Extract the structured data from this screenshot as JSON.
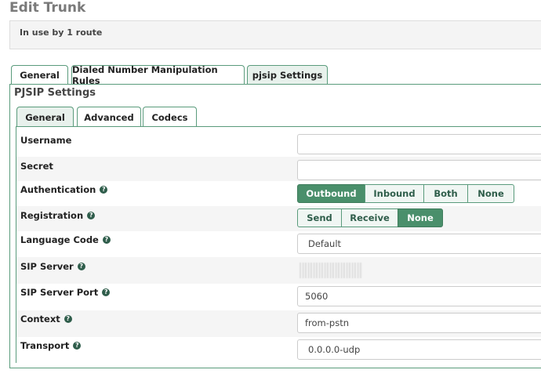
{
  "page": {
    "title": "Edit Trunk"
  },
  "alert": {
    "text": "In use by 1 route"
  },
  "outer_tabs": [
    {
      "label": "General",
      "active": false
    },
    {
      "label": "Dialed Number Manipulation Rules",
      "active": false
    },
    {
      "label": "pjsip Settings",
      "active": true
    }
  ],
  "section": {
    "title": "PJSIP Settings"
  },
  "inner_tabs": [
    {
      "label": "General",
      "active": true
    },
    {
      "label": "Advanced",
      "active": false
    },
    {
      "label": "Codecs",
      "active": false
    }
  ],
  "fields": {
    "username": {
      "label": "Username",
      "value": ""
    },
    "secret": {
      "label": "Secret",
      "value": ""
    },
    "authentication": {
      "label": "Authentication",
      "options": [
        "Outbound",
        "Inbound",
        "Both",
        "None"
      ],
      "selected": "Outbound"
    },
    "registration": {
      "label": "Registration",
      "options": [
        "Send",
        "Receive",
        "None"
      ],
      "selected": "None"
    },
    "language_code": {
      "label": "Language Code",
      "value": "Default"
    },
    "sip_server": {
      "label": "SIP Server",
      "value": ""
    },
    "sip_server_port": {
      "label": "SIP Server Port",
      "value": "5060"
    },
    "context": {
      "label": "Context",
      "value": "from-pstn"
    },
    "transport": {
      "label": "Transport",
      "value": "0.0.0.0-udp"
    }
  },
  "help_icon_glyph": "?",
  "colors": {
    "accent": "#4a8f6b",
    "border": "#5a9b7c",
    "tab_active_bg": "#e8f1ec"
  }
}
